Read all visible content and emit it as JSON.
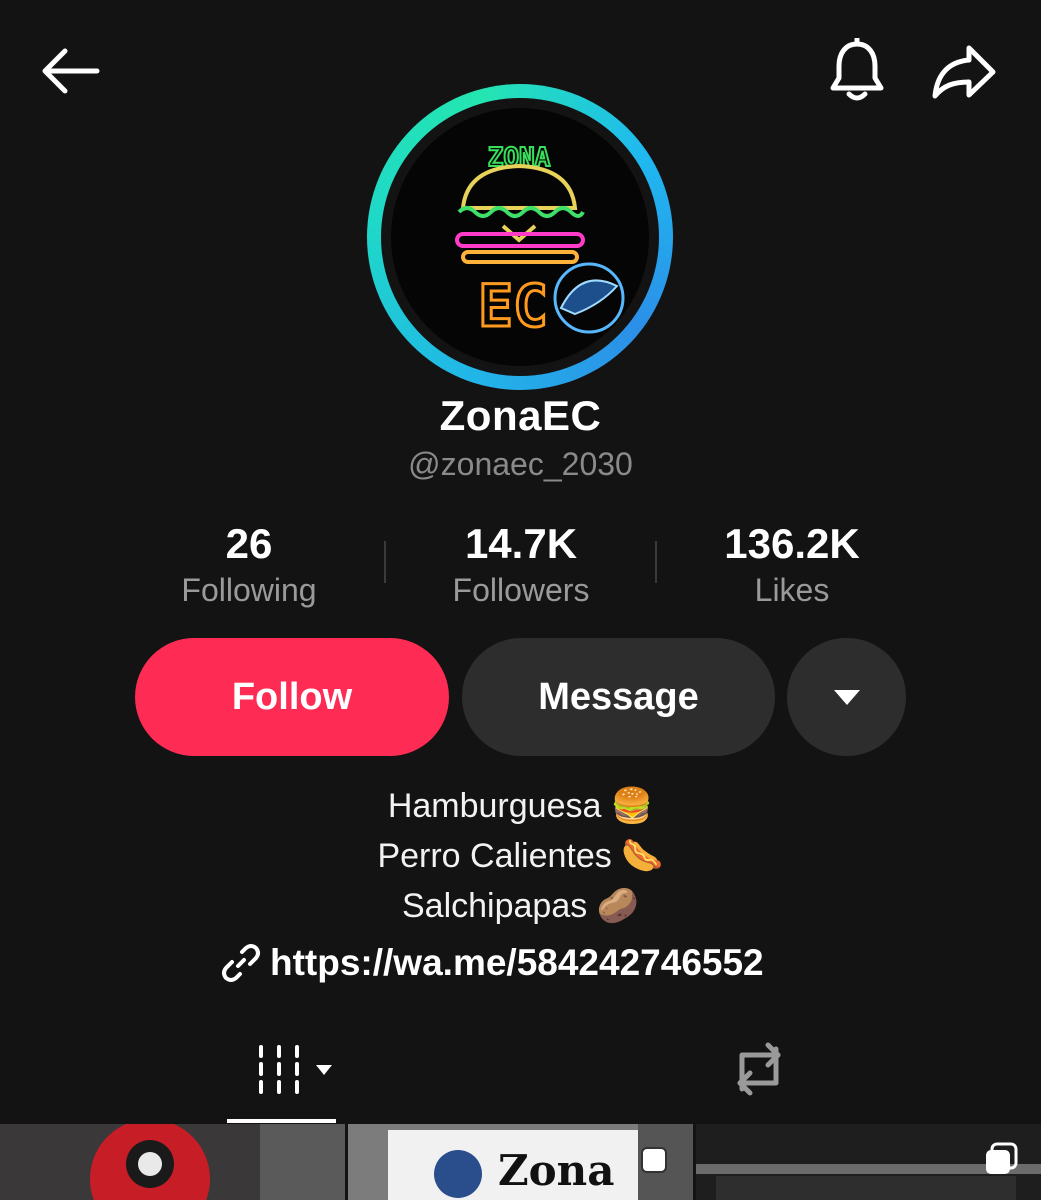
{
  "header": {
    "back_icon": "arrow-left-icon",
    "notify_icon": "bell-icon",
    "share_icon": "share-arrow-icon"
  },
  "profile": {
    "avatar_text_top": "ZONA",
    "avatar_text_bottom": "EC",
    "display_name": "ZonaEC",
    "handle": "@zonaec_2030",
    "ring_colors": [
      "#21b6e8",
      "#24e6b1"
    ]
  },
  "stats": [
    {
      "value": "26",
      "label": "Following"
    },
    {
      "value": "14.7K",
      "label": "Followers"
    },
    {
      "value": "136.2K",
      "label": "Likes"
    }
  ],
  "actions": {
    "follow_label": "Follow",
    "message_label": "Message",
    "more_icon": "caret-down-icon",
    "follow_color": "#fe2c55"
  },
  "bio": {
    "lines": [
      "Hamburguesa 🍔",
      "Perro Calientes 🌭",
      "Salchipapas 🥔"
    ],
    "link": "https://wa.me/584242746552",
    "link_icon": "link-icon"
  },
  "tabs": {
    "videos_icon": "grid-icon",
    "reposts_icon": "repost-icon"
  },
  "grid": {
    "thumb_2_text": "Zona EC"
  }
}
